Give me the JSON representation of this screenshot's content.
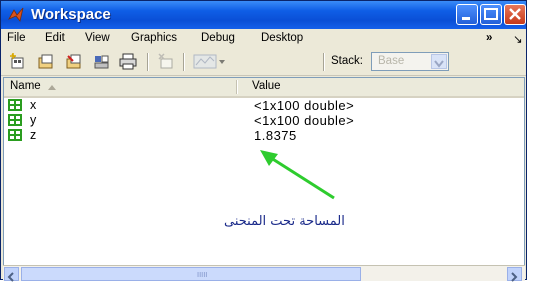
{
  "window": {
    "title": "Workspace"
  },
  "menu": [
    "File",
    "Edit",
    "View",
    "Graphics",
    "Debug",
    "Desktop",
    "»",
    "↘"
  ],
  "toolbar": {
    "stack_label": "Stack:",
    "stack_value": "Base"
  },
  "columns": {
    "name": "Name",
    "value": "Value"
  },
  "variables": [
    {
      "name": "x",
      "value": "<1x100 double>"
    },
    {
      "name": "y",
      "value": "<1x100 double>"
    },
    {
      "name": "z",
      "value": "1.8375"
    }
  ],
  "annotation": "المساحة تحت المنحنى",
  "scroll": {
    "grip": "IIIII"
  },
  "colors": {
    "title_bar": "#0a4fd6",
    "annotation_arrow": "#22cc22",
    "var_icon": "#2a9d1f"
  }
}
